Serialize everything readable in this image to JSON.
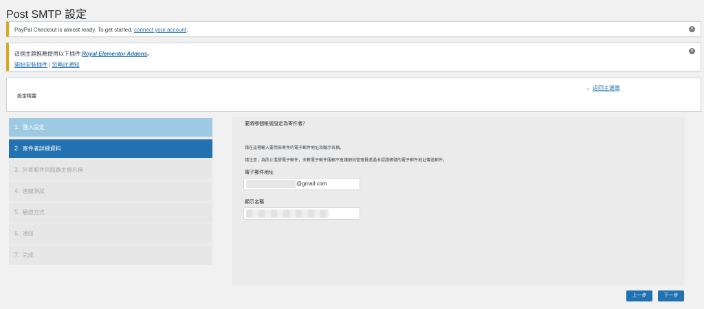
{
  "page": {
    "title": "Post SMTP 設定"
  },
  "notices": {
    "paypal": {
      "text": "PayPal Checkout is almost ready. To get started, ",
      "link": "connect your account",
      "end": "."
    },
    "theme": {
      "text": "這個主題推薦使用以下插件:",
      "plugin_link": "Royal Elementor Addons",
      "text_end": "。",
      "install_link": "開始安裝插件",
      "separator": " | ",
      "dismiss_link": "忽略此通知"
    },
    "dismiss_icon": "✕"
  },
  "summary": {
    "title": "設定精靈",
    "back_link": "返回主選單",
    "back_arrow": "←"
  },
  "steps": [
    {
      "num": "1.",
      "label": "匯入設定",
      "state": "done"
    },
    {
      "num": "2.",
      "label": "寄件者詳細資料",
      "state": "active"
    },
    {
      "num": "3.",
      "label": "外寄郵件伺服器主機名稱",
      "state": "pending"
    },
    {
      "num": "4.",
      "label": "連線測試",
      "state": "pending"
    },
    {
      "num": "5.",
      "label": "驗證方式",
      "state": "pending"
    },
    {
      "num": "6.",
      "label": "通知",
      "state": "pending"
    },
    {
      "num": "7.",
      "label": "完成",
      "state": "pending"
    }
  ],
  "form": {
    "question": "要將哪個帳號設定為寄件者？",
    "desc1": "請在這裡輸入要用來寄件的電子郵件地址及顯示名稱。",
    "desc2": "請注意，為防止濫發電子郵件，多數電子郵件服務不會讓網站管理員透過未認證帳號的電子郵件地址傳送郵件。",
    "email_label": "電子郵件地址",
    "email_suffix": "@gmail.com",
    "name_label": "顯示名稱"
  },
  "buttons": {
    "prev": "上一步",
    "next": "下一步"
  },
  "colors": {
    "accent": "#2271b1",
    "done_step": "#9dc9e2",
    "notice_border": "#dba617"
  }
}
